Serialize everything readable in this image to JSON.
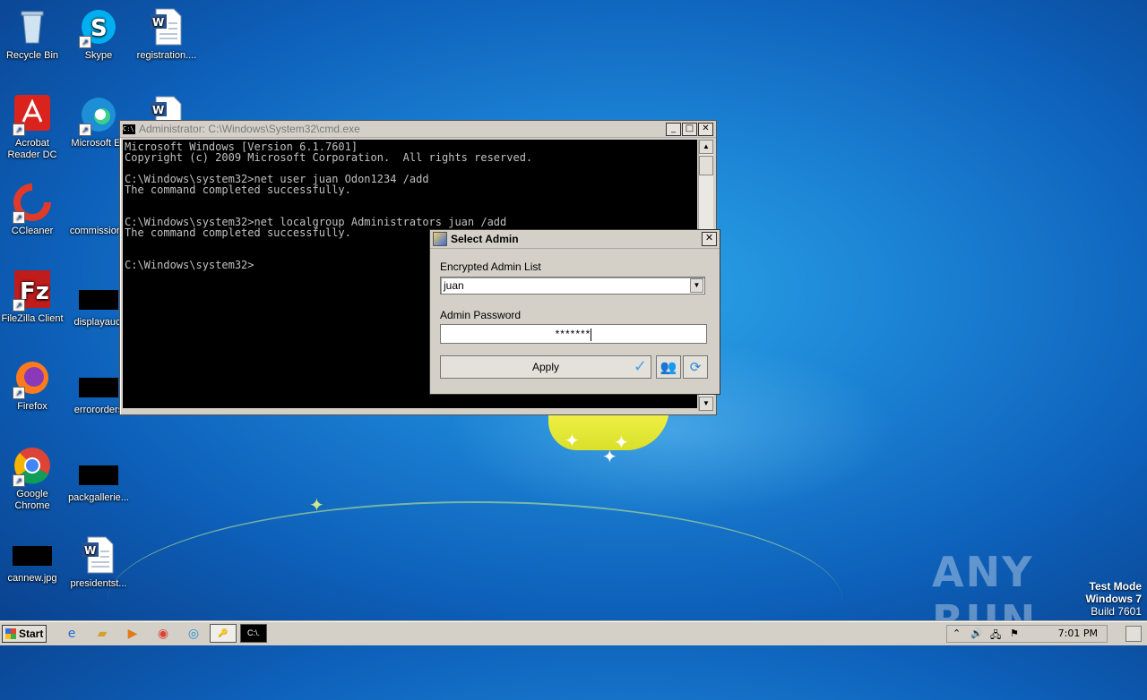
{
  "desktop": {
    "icons": [
      {
        "label": "Recycle Bin",
        "icon": "recycle-bin-icon"
      },
      {
        "label": "Skype",
        "icon": "skype-icon"
      },
      {
        "label": "registration....",
        "icon": "word-document-icon"
      },
      {
        "label": "Acrobat Reader DC",
        "icon": "acrobat-icon"
      },
      {
        "label": "Microsoft Ed",
        "icon": "edge-icon"
      },
      {
        "label": "",
        "icon": "word-document-icon"
      },
      {
        "label": "CCleaner",
        "icon": "ccleaner-icon"
      },
      {
        "label": "commissione",
        "icon": "file-icon"
      },
      {
        "label": "FileZilla Client",
        "icon": "filezilla-icon"
      },
      {
        "label": "displayauct",
        "icon": "black-thumbnail-icon"
      },
      {
        "label": "Firefox",
        "icon": "firefox-icon"
      },
      {
        "label": "errororders",
        "icon": "black-thumbnail-icon"
      },
      {
        "label": "Google Chrome",
        "icon": "chrome-icon"
      },
      {
        "label": "packgallerie...",
        "icon": "black-thumbnail-icon"
      },
      {
        "label": "cannew.jpg",
        "icon": "black-thumbnail-icon"
      },
      {
        "label": "presidentst...",
        "icon": "word-document-icon"
      }
    ]
  },
  "cmd": {
    "title": "Administrator: C:\\Windows\\System32\\cmd.exe",
    "icon_text": "C:\\.",
    "lines": [
      "Microsoft Windows [Version 6.1.7601]",
      "Copyright (c) 2009 Microsoft Corporation.  All rights reserved.",
      "",
      "C:\\Windows\\system32>net user juan Odon1234 /add",
      "The command completed successfully.",
      "",
      "",
      "C:\\Windows\\system32>net localgroup Administrators juan /add",
      "The command completed successfully.",
      "",
      "",
      "C:\\Windows\\system32>"
    ]
  },
  "dialog": {
    "title": "Select Admin",
    "list_label": "Encrypted Admin List",
    "selected_admin": "juan",
    "password_label": "Admin Password",
    "password_mask": "*******",
    "apply_label": "Apply",
    "close_label": "✕"
  },
  "taskbar": {
    "start_label": "Start",
    "clock": "7:01 PM"
  },
  "watermark": {
    "text": "ANY RUN",
    "test_mode": "Test Mode",
    "os": "Windows 7",
    "build": "Build 7601"
  },
  "colors": {
    "desktop_blue": "#1a7fd1",
    "dialog_bg": "#d4d0c8",
    "console_bg": "#000000",
    "console_fg": "#c0c0c0"
  }
}
